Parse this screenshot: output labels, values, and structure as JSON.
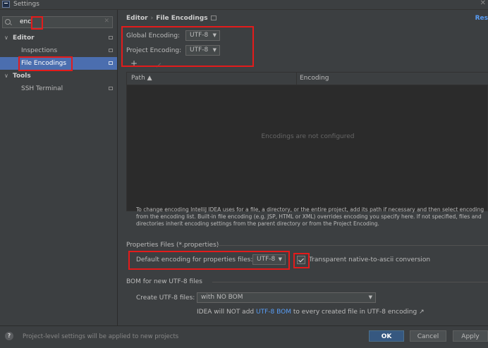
{
  "window": {
    "title": "Settings"
  },
  "search": {
    "value": "enc",
    "clear": "✕"
  },
  "tree": [
    {
      "label": "Editor",
      "kind": "group"
    },
    {
      "label": "Inspections",
      "kind": "item"
    },
    {
      "label": "File Encodings",
      "kind": "item",
      "selected": true
    },
    {
      "label": "Tools",
      "kind": "group"
    },
    {
      "label": "SSH Terminal",
      "kind": "item"
    }
  ],
  "header": {
    "breadcrumb_parent": "Editor",
    "breadcrumb_sep": "›",
    "breadcrumb_current": "File Encodings",
    "reset": "Res"
  },
  "global_encoding": {
    "label": "Global Encoding:",
    "value": "UTF-8"
  },
  "project_encoding": {
    "label": "Project Encoding:",
    "value": "UTF-8"
  },
  "toolbar": {
    "add": "+"
  },
  "table": {
    "col_path": "Path ▲",
    "col_encoding": "Encoding",
    "empty": "Encodings are not configured"
  },
  "help_lines": [
    "To change encoding IntelliJ IDEA uses for a file, a directory, or the entire project, add its path if necessary and then select encoding",
    "from the encoding list. Built-in file encoding (e.g. JSP, HTML or XML) overrides encoding you specify here. If not specified, files and",
    "directories inherit encoding settings from the parent directory or from the Project Encoding."
  ],
  "properties": {
    "section": "Properties Files (*.properties)",
    "default_label": "Default encoding for properties files:",
    "default_value": "UTF-8",
    "transparent_label": "Transparent native-to-ascii conversion",
    "transparent_checked": true
  },
  "bom": {
    "section": "BOM for new UTF-8 files",
    "create_label": "Create UTF-8 files:",
    "create_value": "with NO BOM",
    "note_prefix": "IDEA will NOT add ",
    "note_link": "UTF-8 BOM",
    "note_suffix": " to every created file in UTF-8 encoding ↗"
  },
  "status": {
    "help": "?",
    "message": "Project-level settings will be applied to new projects"
  },
  "buttons": {
    "ok": "OK",
    "cancel": "Cancel",
    "apply": "Apply"
  }
}
